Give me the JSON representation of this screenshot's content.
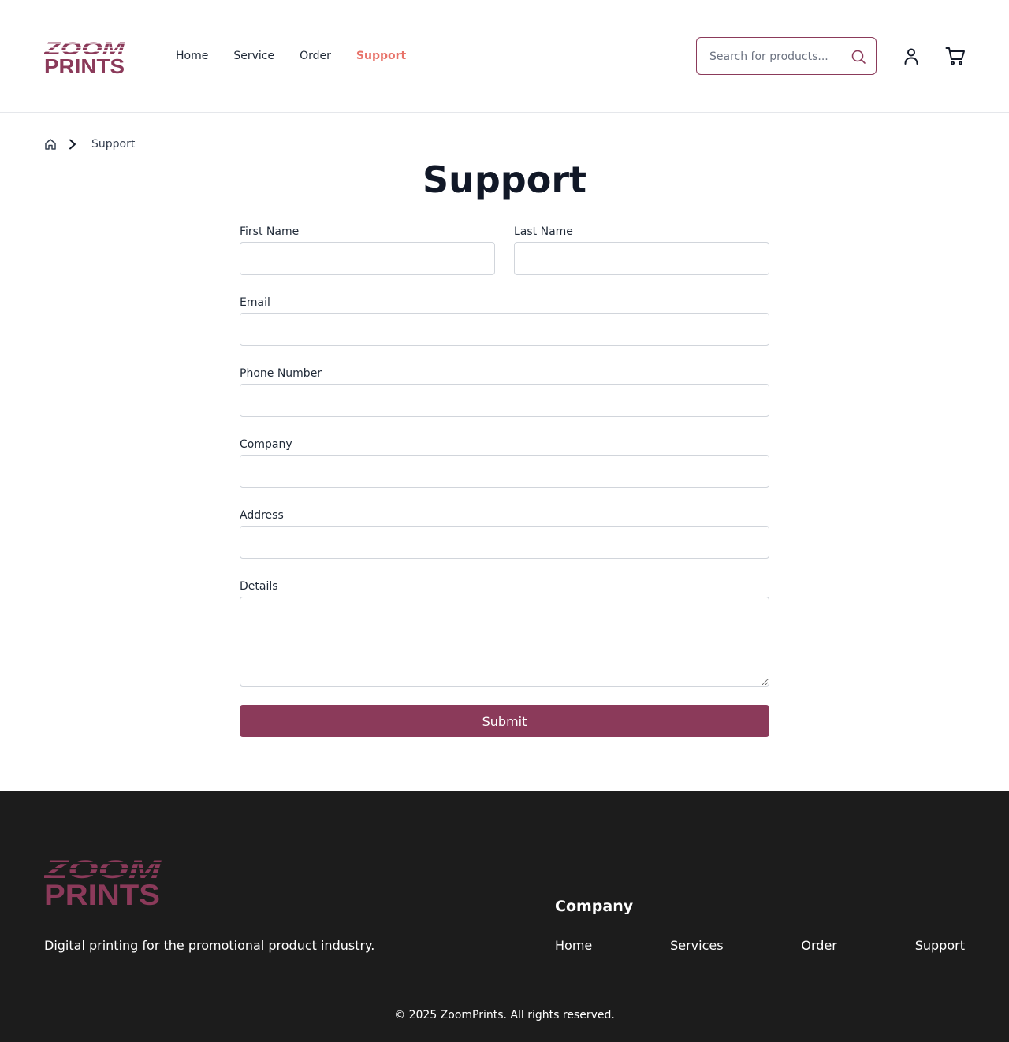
{
  "brand": {
    "logo_line1": "ZOOM",
    "logo_line2": "PRINTS",
    "color": "#8b3a5a"
  },
  "nav": {
    "items": [
      {
        "label": "Home"
      },
      {
        "label": "Service"
      },
      {
        "label": "Order"
      },
      {
        "label": "Support",
        "active": true
      }
    ],
    "active_color": "#e8736a"
  },
  "search": {
    "placeholder": "Search for products..."
  },
  "icons": {
    "search": "search-icon",
    "user": "user-icon",
    "cart": "cart-icon",
    "home": "home-icon",
    "chevron": "chevron-right-icon"
  },
  "breadcrumb": {
    "current": "Support"
  },
  "page": {
    "title": "Support"
  },
  "form": {
    "first_name_label": "First Name",
    "first_name_value": "",
    "last_name_label": "Last Name",
    "last_name_value": "",
    "email_label": "Email",
    "email_value": "",
    "phone_label": "Phone Number",
    "phone_value": "",
    "company_label": "Company",
    "company_value": "",
    "address_label": "Address",
    "address_value": "",
    "details_label": "Details",
    "details_value": "",
    "submit_label": "Submit"
  },
  "footer": {
    "tagline": "Digital printing for the promotional product industry.",
    "company_heading": "Company",
    "links": [
      {
        "label": "Home"
      },
      {
        "label": "Services"
      },
      {
        "label": "Order"
      },
      {
        "label": "Support"
      }
    ],
    "copyright": "© 2025 ZoomPrints. All rights reserved.",
    "background": "#1c1c1c"
  }
}
